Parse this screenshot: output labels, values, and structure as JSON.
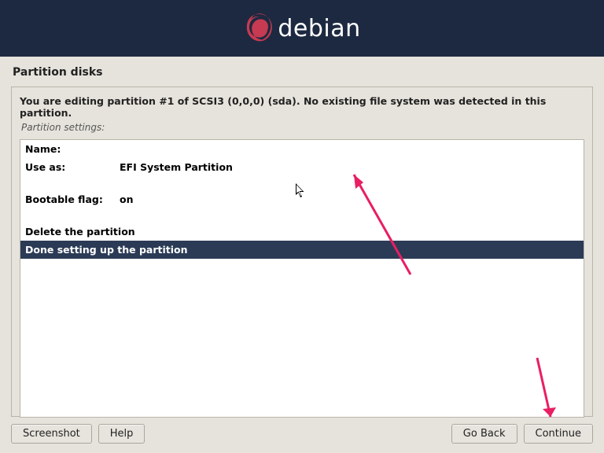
{
  "brand": "debian",
  "page_title": "Partition disks",
  "instruction": "You are editing partition #1 of SCSI3 (0,0,0) (sda). No existing file system was detected in this partition.",
  "subheading": "Partition settings:",
  "settings": {
    "name_label": "Name:",
    "name_value": "",
    "useas_label": "Use as:",
    "useas_value": "EFI System Partition",
    "bootable_label": "Bootable flag:",
    "bootable_value": "on"
  },
  "actions": {
    "delete": "Delete the partition",
    "done": "Done setting up the partition"
  },
  "buttons": {
    "screenshot": "Screenshot",
    "help": "Help",
    "go_back": "Go Back",
    "continue": "Continue"
  }
}
